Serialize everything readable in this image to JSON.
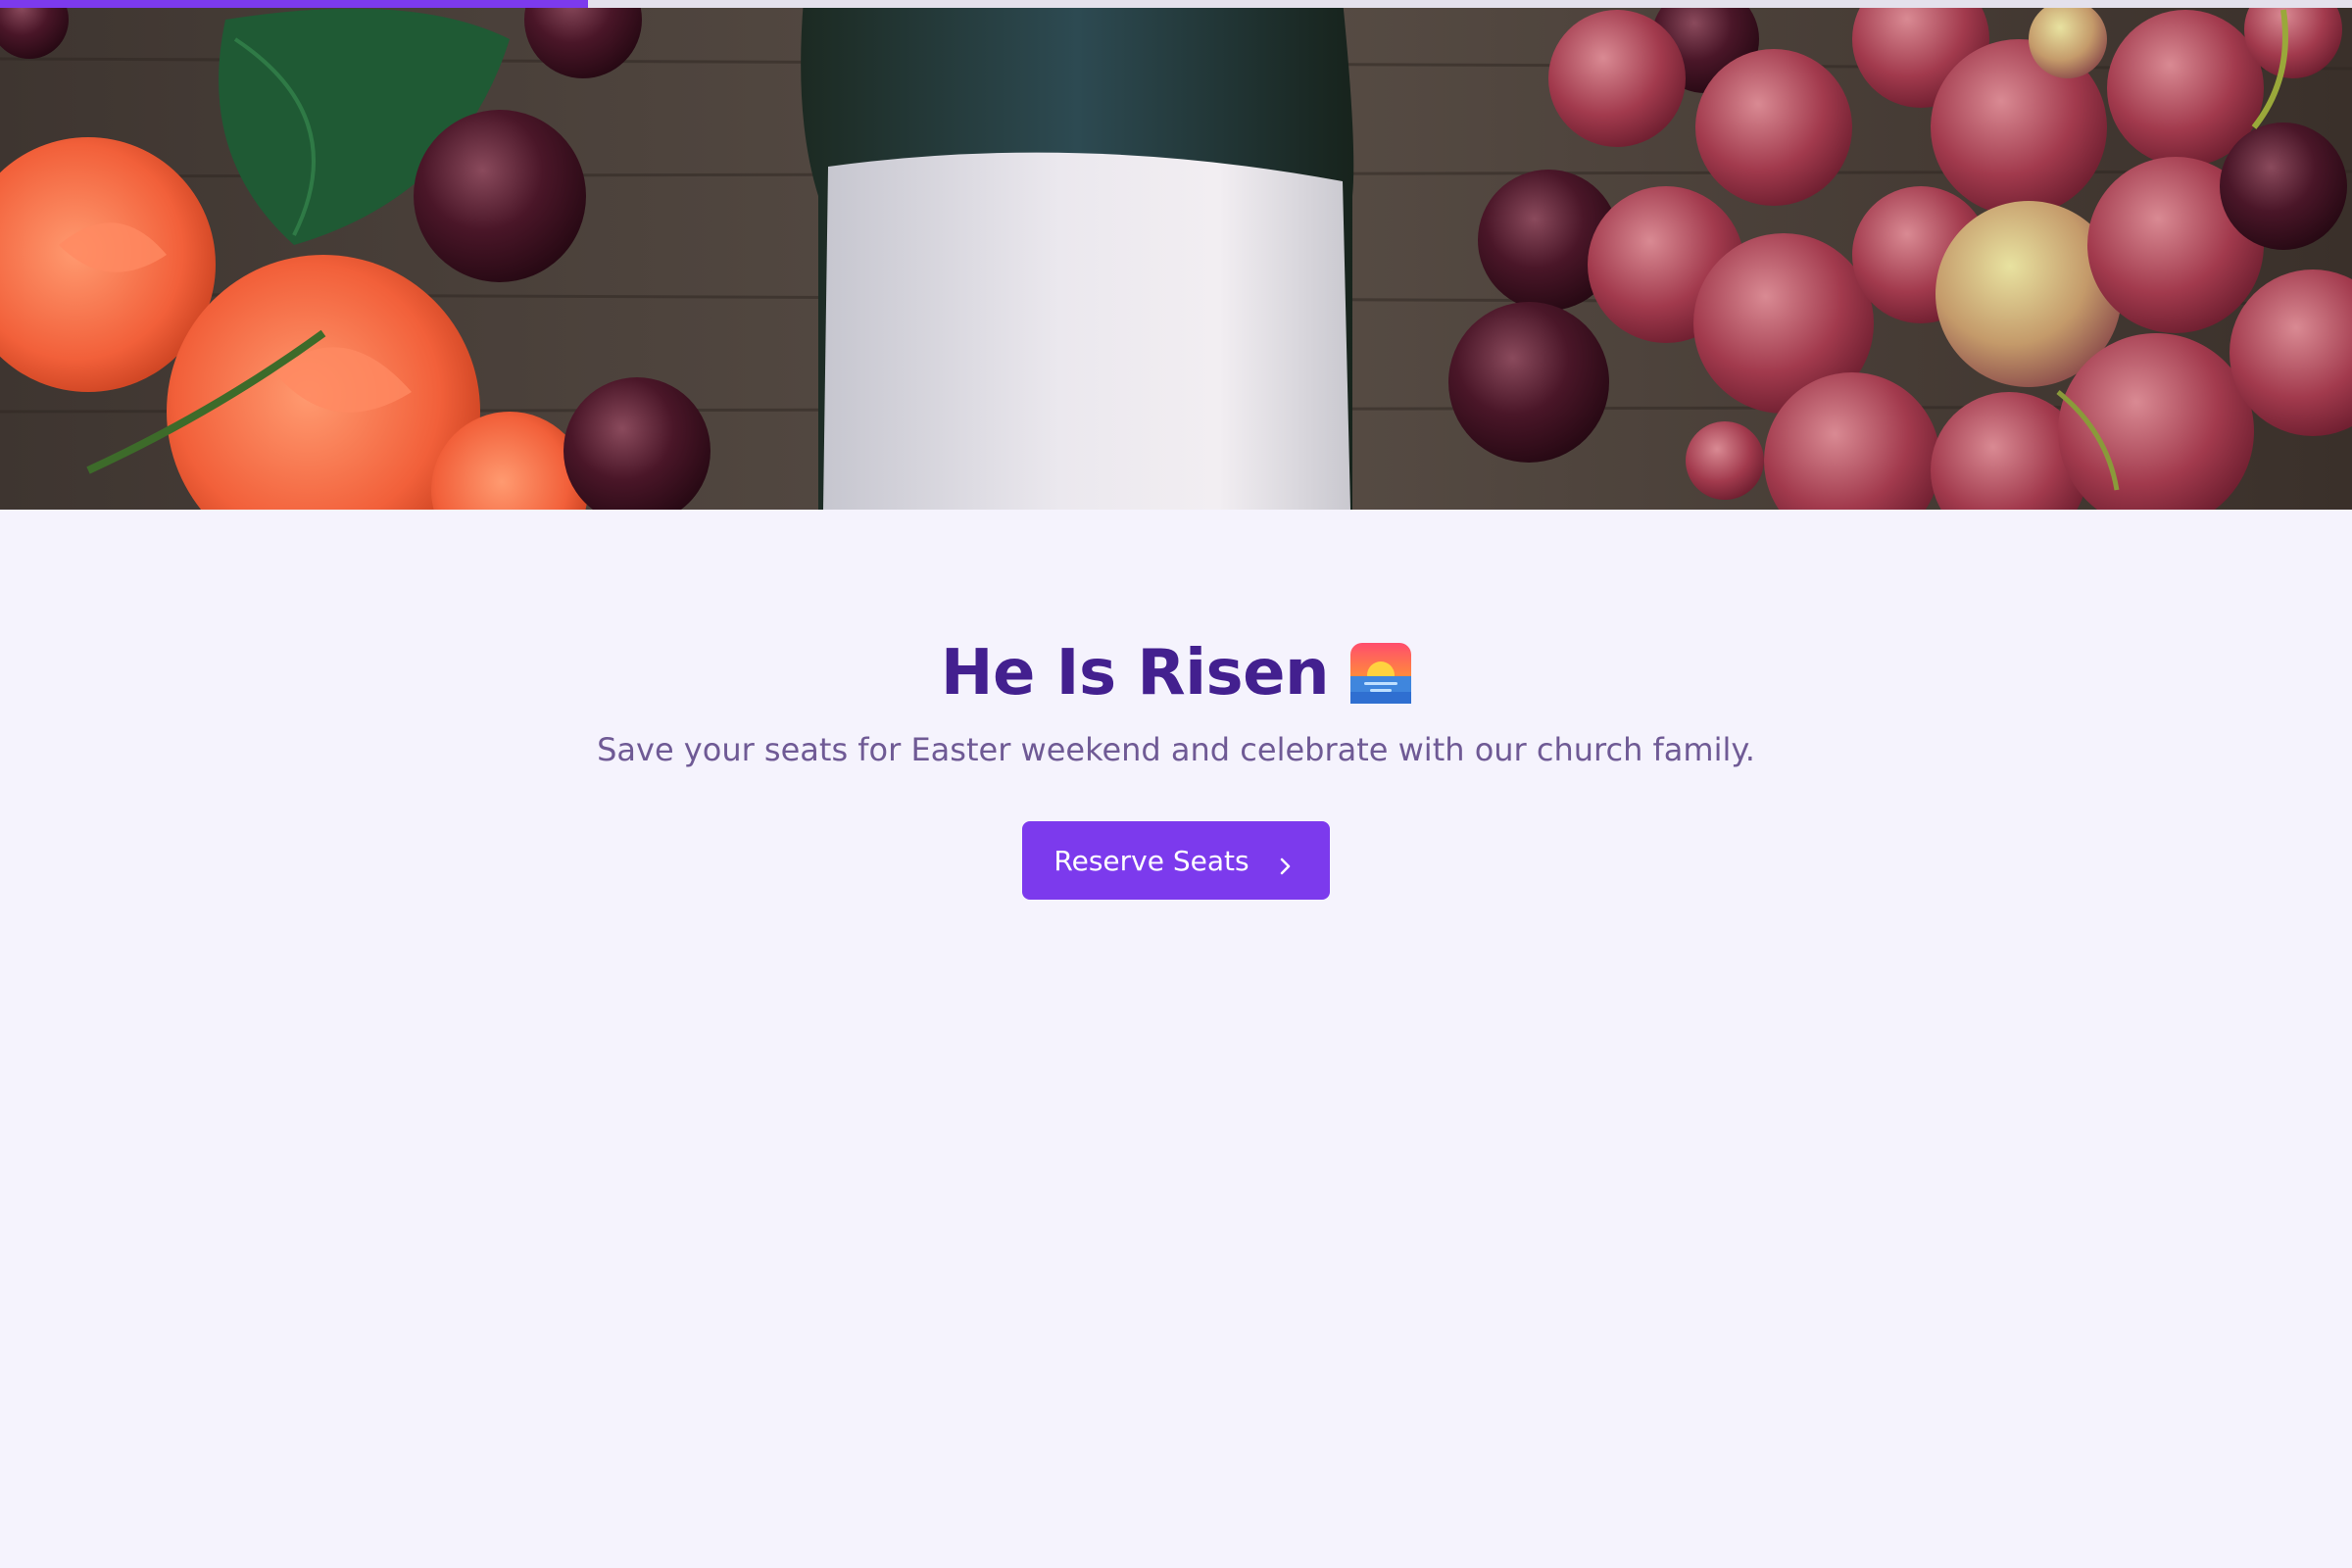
{
  "progress": {
    "fraction": 0.25,
    "color": "#7c3aed"
  },
  "hero": {
    "image": "wine-bottle-grapes-roses-photo"
  },
  "headline": {
    "text": "He Is Risen",
    "icon": "sunrise-icon"
  },
  "subtitle": {
    "text": "Save your seats for Easter weekend and celebrate with our church family."
  },
  "cta": {
    "label": "Reserve Seats",
    "icon": "chevron-right-icon"
  },
  "colors": {
    "accent": "#7c3aed",
    "heading": "#43208f",
    "subtitle": "#6f5a95",
    "background": "#f5f3fd"
  }
}
